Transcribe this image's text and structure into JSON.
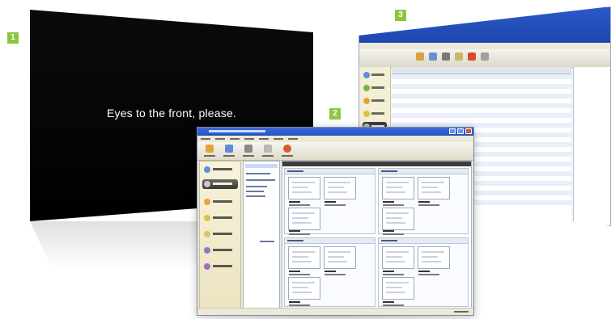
{
  "badges": {
    "one": "1",
    "two": "2",
    "three": "3"
  },
  "screen1": {
    "message": "Eyes to the front, please."
  },
  "colors": {
    "badge_green": "#8cc63f",
    "xp_title_blue": "#2453c4",
    "sidebar_beige": "#f3eed6",
    "active_nav": "#3a3831"
  },
  "icons": [
    "home-icon",
    "folder-icon",
    "music-icon",
    "photo-icon",
    "screen-icon",
    "apps-icon",
    "gear-icon",
    "refresh-icon",
    "stop-icon"
  ]
}
